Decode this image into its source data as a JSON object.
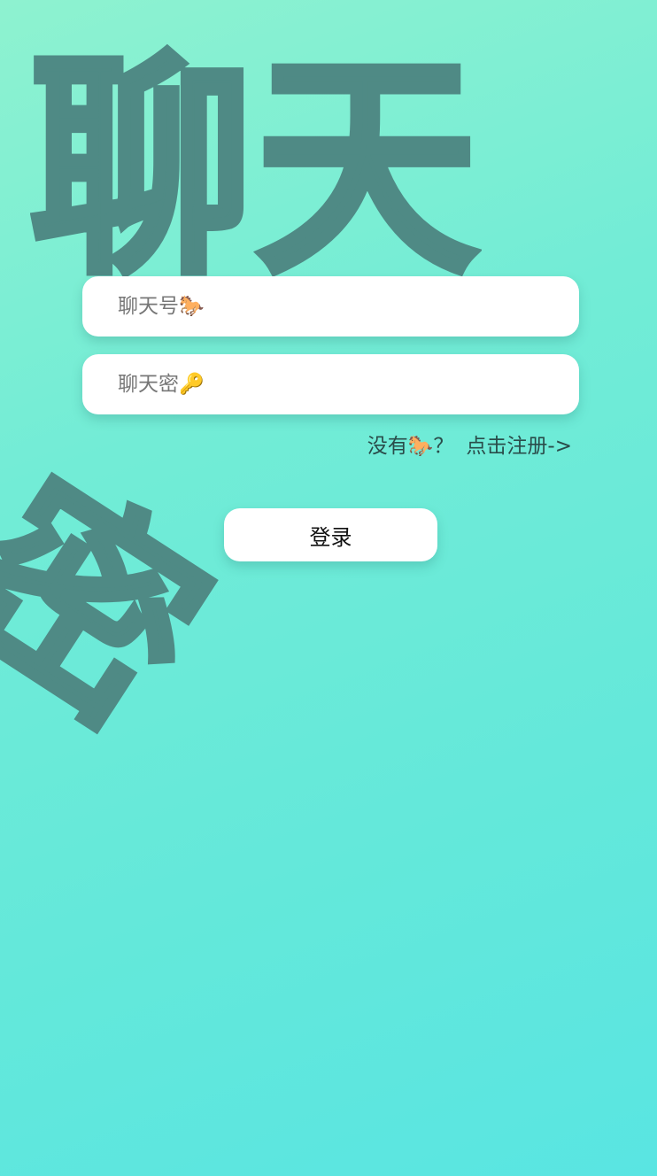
{
  "background": {
    "title_text": "聊天",
    "rotated_text": "密"
  },
  "login_form": {
    "account_placeholder": "聊天号🐎",
    "account_value": "",
    "password_placeholder": "聊天密🔑",
    "password_value": "",
    "register_prompt": "没有🐎？",
    "register_link_label": "点击注册->",
    "login_button_label": "登录"
  },
  "colors": {
    "gradient_start": "#8ef2d0",
    "gradient_end": "#59e5e2",
    "decor_text": "#4f8a85",
    "field_background": "#ffffff"
  }
}
